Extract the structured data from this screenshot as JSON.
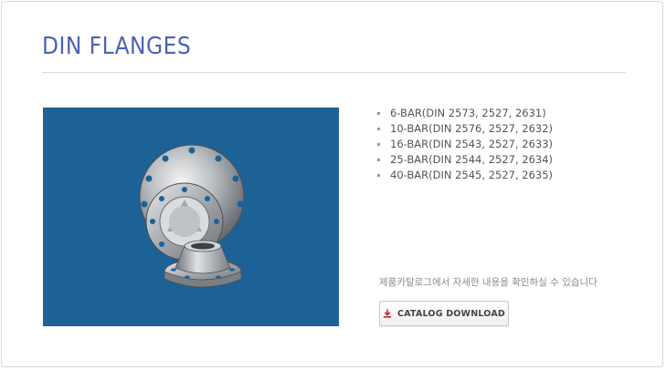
{
  "page": {
    "title": "DIN FLANGES"
  },
  "product_image": {
    "description_icon": "flange-photo",
    "background_color": "#1c6296"
  },
  "specs": [
    " 6-BAR(DIN 2573, 2527, 2631)",
    "10-BAR(DIN 2576, 2527, 2632)",
    "16-BAR(DIN 2543, 2527, 2633)",
    "25-BAR(DIN 2544, 2527, 2634)",
    "40-BAR(DIN 2545, 2527, 2635)"
  ],
  "notice": "제품카탈로그에서 자세한 내용을 확인하실 수 있습니다",
  "catalog_button": {
    "label": "CATALOG DOWNLOAD",
    "icon": "download-icon",
    "icon_color": "#c0272d"
  },
  "colors": {
    "title": "#4a63b4",
    "text": "#555555"
  }
}
